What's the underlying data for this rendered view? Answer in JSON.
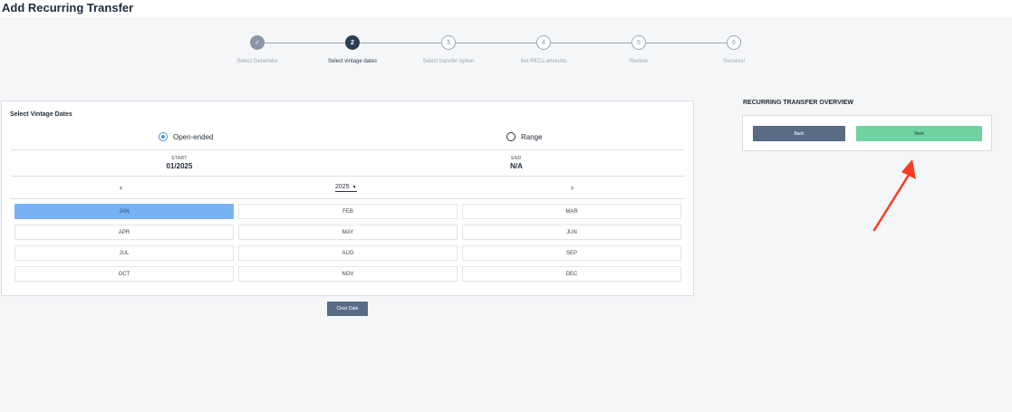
{
  "page": {
    "title": "Add Recurring Transfer"
  },
  "stepper": {
    "steps": [
      {
        "number": "",
        "label": "Select Generator",
        "state": "done"
      },
      {
        "number": "2",
        "label": "Select vintage dates",
        "state": "current"
      },
      {
        "number": "3",
        "label": "Select transfer option",
        "state": "todo"
      },
      {
        "number": "4",
        "label": "Set RECs amounts",
        "state": "todo"
      },
      {
        "number": "5",
        "label": "Review",
        "state": "todo"
      },
      {
        "number": "6",
        "label": "Success!",
        "state": "todo"
      }
    ],
    "check_glyph": "✓"
  },
  "vintage": {
    "title": "Select Vintage Dates",
    "options": {
      "open_ended": "Open-ended",
      "range": "Range",
      "selected": "open_ended"
    },
    "start": {
      "caption": "START",
      "value": "01/2025"
    },
    "end": {
      "caption": "END",
      "value": "N/A"
    },
    "year": "2025",
    "prev_glyph": "‹",
    "next_glyph": "›",
    "months": [
      "JAN",
      "FEB",
      "MAR",
      "APR",
      "MAY",
      "JUN",
      "JUL",
      "AUG",
      "SEP",
      "OCT",
      "NOV",
      "DEC"
    ],
    "selected_month": "JAN",
    "clear_label": "Clear Date"
  },
  "overview": {
    "title": "RECURRING TRANSFER OVERVIEW",
    "back_label": "Back",
    "next_label": "Next"
  },
  "colors": {
    "current_step": "#2c3e56",
    "selected_month": "#77b1f3",
    "next_button": "#6ed3a0",
    "back_button": "#5a6b85",
    "annotation_arrow": "#ff3b1f"
  }
}
